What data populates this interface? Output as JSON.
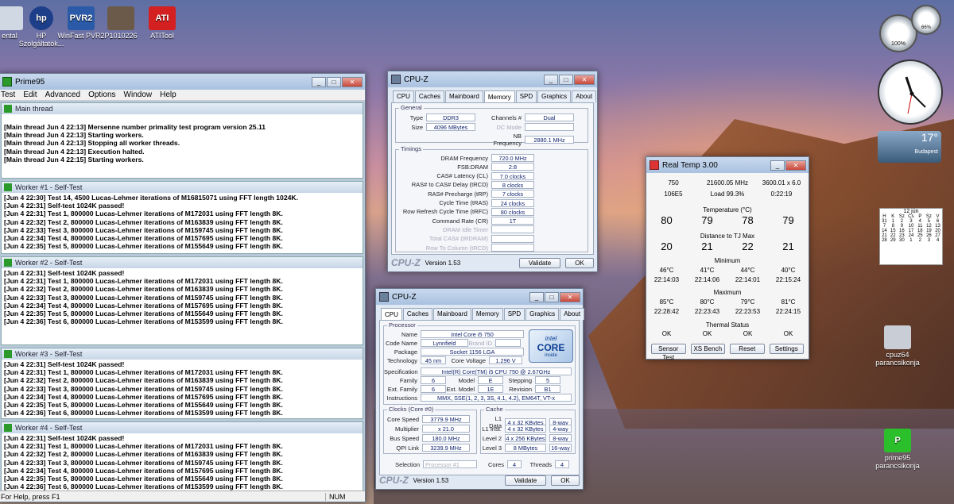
{
  "desktop": {
    "icons": [
      {
        "label": "ental",
        "glyph": ""
      },
      {
        "label": "HP Szolgáltatók...",
        "glyph": "hp"
      },
      {
        "label": "WinFast PVR2",
        "glyph": "PVR2"
      },
      {
        "label": "P1010226",
        "glyph": ""
      },
      {
        "label": "ATITool",
        "glyph": "ATI"
      },
      {
        "label": "cpuz64 parancsikonja",
        "glyph": ""
      },
      {
        "label": "prime95 parancsikonja",
        "glyph": "P"
      }
    ]
  },
  "prime95": {
    "title": "Prime95",
    "menu": [
      "Test",
      "Edit",
      "Advanced",
      "Options",
      "Window",
      "Help"
    ],
    "children": [
      {
        "title": "Main thread",
        "lines": [
          "",
          "[Main thread Jun 4 22:13] Mersenne number primality test program version 25.11",
          "[Main thread Jun 4 22:13] Starting workers.",
          "[Main thread Jun 4 22:13] Stopping all worker threads.",
          "[Main thread Jun 4 22:13] Execution halted.",
          "[Main thread Jun 4 22:15] Starting workers."
        ]
      },
      {
        "title": "Worker #1 - Self-Test",
        "lines": [
          "[Jun 4 22:30] Test 14, 4500 Lucas-Lehmer iterations of M16815071 using FFT length 1024K.",
          "[Jun 4 22:31] Self-test 1024K passed!",
          "[Jun 4 22:31] Test 1, 800000 Lucas-Lehmer iterations of M172031 using FFT length 8K.",
          "[Jun 4 22:32] Test 2, 800000 Lucas-Lehmer iterations of M163839 using FFT length 8K.",
          "[Jun 4 22:33] Test 3, 800000 Lucas-Lehmer iterations of M159745 using FFT length 8K.",
          "[Jun 4 22:34] Test 4, 800000 Lucas-Lehmer iterations of M157695 using FFT length 8K.",
          "[Jun 4 22:35] Test 5, 800000 Lucas-Lehmer iterations of M155649 using FFT length 8K."
        ]
      },
      {
        "title": "Worker #2 - Self-Test",
        "lines": [
          "[Jun 4 22:31] Self-test 1024K passed!",
          "[Jun 4 22:31] Test 1, 800000 Lucas-Lehmer iterations of M172031 using FFT length 8K.",
          "[Jun 4 22:32] Test 2, 800000 Lucas-Lehmer iterations of M163839 using FFT length 8K.",
          "[Jun 4 22:33] Test 3, 800000 Lucas-Lehmer iterations of M159745 using FFT length 8K.",
          "[Jun 4 22:34] Test 4, 800000 Lucas-Lehmer iterations of M157695 using FFT length 8K.",
          "[Jun 4 22:35] Test 5, 800000 Lucas-Lehmer iterations of M155649 using FFT length 8K.",
          "[Jun 4 22:36] Test 6, 800000 Lucas-Lehmer iterations of M153599 using FFT length 8K."
        ]
      },
      {
        "title": "Worker #3 - Self-Test",
        "lines": [
          "[Jun 4 22:31] Self-test 1024K passed!",
          "[Jun 4 22:31] Test 1, 800000 Lucas-Lehmer iterations of M172031 using FFT length 8K.",
          "[Jun 4 22:32] Test 2, 800000 Lucas-Lehmer iterations of M163839 using FFT length 8K.",
          "[Jun 4 22:33] Test 3, 800000 Lucas-Lehmer iterations of M159745 using FFT length 8K.",
          "[Jun 4 22:34] Test 4, 800000 Lucas-Lehmer iterations of M157695 using FFT length 8K.",
          "[Jun 4 22:35] Test 5, 800000 Lucas-Lehmer iterations of M155649 using FFT length 8K.",
          "[Jun 4 22:36] Test 6, 800000 Lucas-Lehmer iterations of M153599 using FFT length 8K."
        ]
      },
      {
        "title": "Worker #4 - Self-Test",
        "lines": [
          "[Jun 4 22:31] Self-test 1024K passed!",
          "[Jun 4 22:31] Test 1, 800000 Lucas-Lehmer iterations of M172031 using FFT length 8K.",
          "[Jun 4 22:32] Test 2, 800000 Lucas-Lehmer iterations of M163839 using FFT length 8K.",
          "[Jun 4 22:33] Test 3, 800000 Lucas-Lehmer iterations of M159745 using FFT length 8K.",
          "[Jun 4 22:34] Test 4, 800000 Lucas-Lehmer iterations of M157695 using FFT length 8K.",
          "[Jun 4 22:35] Test 5, 800000 Lucas-Lehmer iterations of M155649 using FFT length 8K.",
          "[Jun 4 22:36] Test 6, 800000 Lucas-Lehmer iterations of M153599 using FFT length 8K."
        ]
      }
    ],
    "status_left": "For Help, press F1",
    "status_num": "NUM"
  },
  "cpuz_memory": {
    "title": "CPU-Z",
    "tabs": [
      "CPU",
      "Caches",
      "Mainboard",
      "Memory",
      "SPD",
      "Graphics",
      "About"
    ],
    "active_tab": "Memory",
    "general_label": "General",
    "type_label": "Type",
    "type": "DDR3",
    "size_label": "Size",
    "size": "4096 MBytes",
    "channels_label": "Channels #",
    "channels": "Dual",
    "dc_mode_label": "DC Mode",
    "dc_mode": "",
    "nb_freq_label": "NB Frequency",
    "nb_freq": "2880.1 MHz",
    "timings_label": "Timings",
    "timings": [
      {
        "label": "DRAM Frequency",
        "value": "720.0 MHz",
        "dim": false
      },
      {
        "label": "FSB:DRAM",
        "value": "2:8",
        "dim": false
      },
      {
        "label": "CAS# Latency (CL)",
        "value": "7.0 clocks",
        "dim": false
      },
      {
        "label": "RAS# to CAS# Delay (tRCD)",
        "value": "8 clocks",
        "dim": false
      },
      {
        "label": "RAS# Precharge (tRP)",
        "value": "7 clocks",
        "dim": false
      },
      {
        "label": "Cycle Time (tRAS)",
        "value": "24 clocks",
        "dim": false
      },
      {
        "label": "Row Refresh Cycle Time (tRFC)",
        "value": "80 clocks",
        "dim": false
      },
      {
        "label": "Command Rate (CR)",
        "value": "1T",
        "dim": false
      },
      {
        "label": "DRAM Idle Timer",
        "value": "",
        "dim": true
      },
      {
        "label": "Total CAS# (tRDRAM)",
        "value": "",
        "dim": true
      },
      {
        "label": "Row To Column (tRCD)",
        "value": "",
        "dim": true
      }
    ],
    "version": "Version 1.53",
    "logo": "CPU-Z",
    "validate": "Validate",
    "ok": "OK"
  },
  "cpuz_cpu": {
    "title": "CPU-Z",
    "tabs": [
      "CPU",
      "Caches",
      "Mainboard",
      "Memory",
      "SPD",
      "Graphics",
      "About"
    ],
    "active_tab": "CPU",
    "processor_label": "Processor",
    "name_label": "Name",
    "name": "Intel Core i5 750",
    "codename_label": "Code Name",
    "codename": "Lynnfield",
    "brand_label": "Brand ID",
    "brand": "",
    "package_label": "Package",
    "package": "Socket 1156 LGA",
    "tech_label": "Technology",
    "tech": "45 nm",
    "voltage_label": "Core Voltage",
    "voltage": "1.296 V",
    "spec_label": "Specification",
    "spec": "Intel(R) Core(TM) i5 CPU     750 @ 2.67GHz",
    "family_label": "Family",
    "family": "6",
    "model_label": "Model",
    "model": "E",
    "stepping_label": "Stepping",
    "stepping": "5",
    "extfamily_label": "Ext. Family",
    "extfamily": "6",
    "extmodel_label": "Ext. Model",
    "extmodel": "1E",
    "revision_label": "Revision",
    "revision": "B1",
    "instr_label": "Instructions",
    "instr": "MMX, SSE(1, 2, 3, 3S, 4.1, 4.2), EM64T, VT-x",
    "clocks_label": "Clocks (Core #0)",
    "core_speed_label": "Core Speed",
    "core_speed": "3779.9 MHz",
    "multiplier_label": "Multiplier",
    "multiplier": "x 21.0",
    "bus_label": "Bus Speed",
    "bus": "180.0 MHz",
    "qpi_label": "QPI Link",
    "qpi": "3239.9 MHz",
    "cache_label": "Cache",
    "caches": [
      {
        "label": "L1 Data",
        "value": "4 x 32 KBytes",
        "way": "8-way"
      },
      {
        "label": "L1 Inst.",
        "value": "4 x 32 KBytes",
        "way": "4-way"
      },
      {
        "label": "Level 2",
        "value": "4 x 256 KBytes",
        "way": "8-way"
      },
      {
        "label": "Level 3",
        "value": "8 MBytes",
        "way": "16-way"
      }
    ],
    "selection_label": "Selection",
    "selection": "Processor #1",
    "cores_label": "Cores",
    "cores": "4",
    "threads_label": "Threads",
    "threads": "4",
    "badge_top": "intel",
    "badge_mid": "CORE",
    "badge_bot": "inside",
    "badge_num": "i5",
    "version": "Version 1.53",
    "logo": "CPU-Z",
    "validate": "Validate",
    "ok": "OK"
  },
  "realtemp": {
    "title": "Real Temp 3.00",
    "top1": [
      "750",
      "21600.05 MHz",
      "3600.01 x 6.0"
    ],
    "top2": [
      "106E5",
      "Load  99.3%",
      "0:22:19"
    ],
    "temp_label": "Temperature (°C)",
    "temps": [
      "80",
      "79",
      "78",
      "79"
    ],
    "tj_label": "Distance to TJ Max",
    "tj": [
      "20",
      "21",
      "22",
      "21"
    ],
    "min_label": "Minimum",
    "min_temps": [
      "46°C",
      "41°C",
      "44°C",
      "40°C"
    ],
    "min_times": [
      "22:14:03",
      "22:14:06",
      "22:14:01",
      "22:15:24"
    ],
    "max_label": "Maximum",
    "max_temps": [
      "85°C",
      "80°C",
      "79°C",
      "81°C"
    ],
    "max_times": [
      "22:28:42",
      "22:23:43",
      "22:23:53",
      "22:24:15"
    ],
    "thermal_label": "Thermal Status",
    "thermal": [
      "OK",
      "OK",
      "OK",
      "OK"
    ],
    "buttons": [
      "Sensor Test",
      "XS Bench",
      "Reset",
      "Settings"
    ]
  },
  "gadgets": {
    "weather_temp": "17°",
    "weather_city": "Budapest",
    "meter1": "100%",
    "meter2": "66%",
    "calendar_month": "12 jún",
    "calendar_days": [
      "H",
      "K",
      "Sz",
      "Cs",
      "P",
      "Sz",
      "V"
    ],
    "calendar_rows": [
      [
        "31",
        "1",
        "2",
        "3",
        "4",
        "5",
        "6"
      ],
      [
        "7",
        "8",
        "9",
        "10",
        "11",
        "12",
        "13"
      ],
      [
        "14",
        "15",
        "16",
        "17",
        "18",
        "19",
        "20"
      ],
      [
        "21",
        "22",
        "23",
        "24",
        "25",
        "26",
        "27"
      ],
      [
        "28",
        "29",
        "30",
        "1",
        "2",
        "3",
        "4"
      ]
    ]
  }
}
